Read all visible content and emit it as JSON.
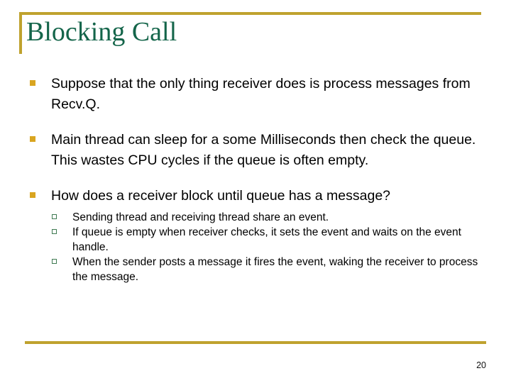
{
  "slide": {
    "title": "Blocking Call",
    "page_number": "20",
    "accent_color": "#bfa22e",
    "title_color": "#14654a",
    "bullet_color": "#d9a520",
    "subbullet_color": "#3f7a52",
    "bullets": [
      {
        "text": "Suppose that the only thing receiver does is process messages from Recv.Q.",
        "marker": "filled-square-bullet-icon",
        "sub_bullets": []
      },
      {
        "text": "Main thread can sleep for a some Milliseconds then check the queue.  This wastes CPU cycles if the queue is often empty.",
        "marker": "filled-square-bullet-icon",
        "sub_bullets": []
      },
      {
        "text": "How does a receiver block until queue has a message?",
        "marker": "filled-square-bullet-icon",
        "sub_bullets": [
          "Sending thread and receiving thread share an event.",
          "If queue is empty when receiver checks, it sets the event and waits on the event handle.",
          "When the sender posts a message it fires the event, waking the receiver to process the message."
        ]
      }
    ]
  }
}
